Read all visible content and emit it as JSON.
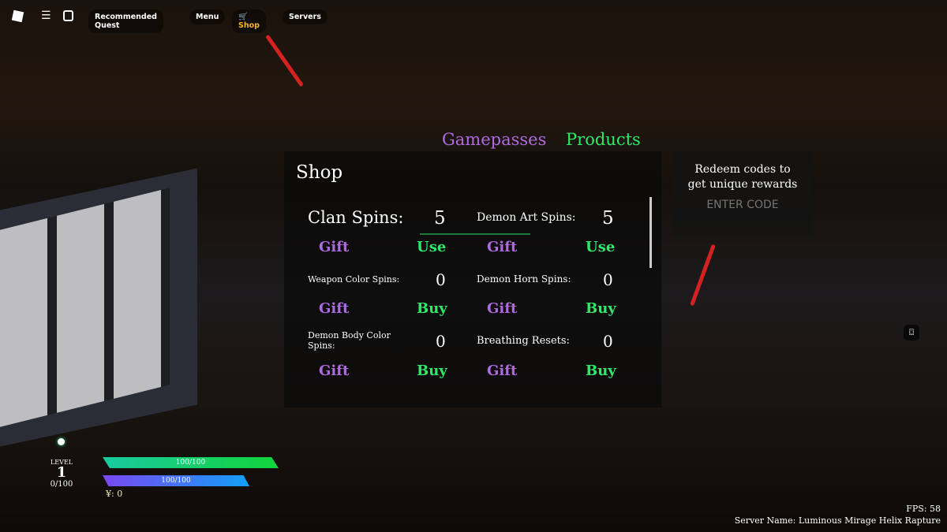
{
  "topbar": {
    "items": [
      "Recommended Quest",
      "Menu",
      "Shop",
      "Servers"
    ],
    "active": "Shop",
    "shop_color": "#f5b623"
  },
  "shop": {
    "tabs": [
      "Gamepasses",
      "Products"
    ],
    "title": "Shop",
    "items": [
      {
        "label": "Clan Spins:",
        "value": "5",
        "gift": "Gift",
        "action": "Use"
      },
      {
        "label": "Demon Art Spins:",
        "value": "5",
        "gift": "Gift",
        "action": "Use"
      },
      {
        "label": "Weapon Color Spins:",
        "value": "0",
        "gift": "Gift",
        "action": "Buy"
      },
      {
        "label": "Demon Horn Spins:",
        "value": "0",
        "gift": "Gift",
        "action": "Buy"
      },
      {
        "label": "Demon Body Color Spins:",
        "value": "0",
        "gift": "Gift",
        "action": "Buy"
      },
      {
        "label": "Breathing Resets:",
        "value": "0",
        "gift": "Gift",
        "action": "Buy"
      }
    ]
  },
  "redeem": {
    "text": "Redeem codes to get unique rewards",
    "placeholder": "ENTER CODE"
  },
  "hud": {
    "level_label": "LEVEL",
    "level": "1",
    "xp": "0/100",
    "health": "100/100",
    "health_fraction": 1.0,
    "stamina": "100/100",
    "stamina_fraction": 1.0,
    "currency": "¥: 0"
  },
  "footer": {
    "fps": "FPS: 58",
    "server": "Server Name: Luminous Mirage Helix Rapture"
  },
  "colors": {
    "gift": "#b06ae0",
    "action": "#2ee86a",
    "arrow": "#d42222"
  }
}
